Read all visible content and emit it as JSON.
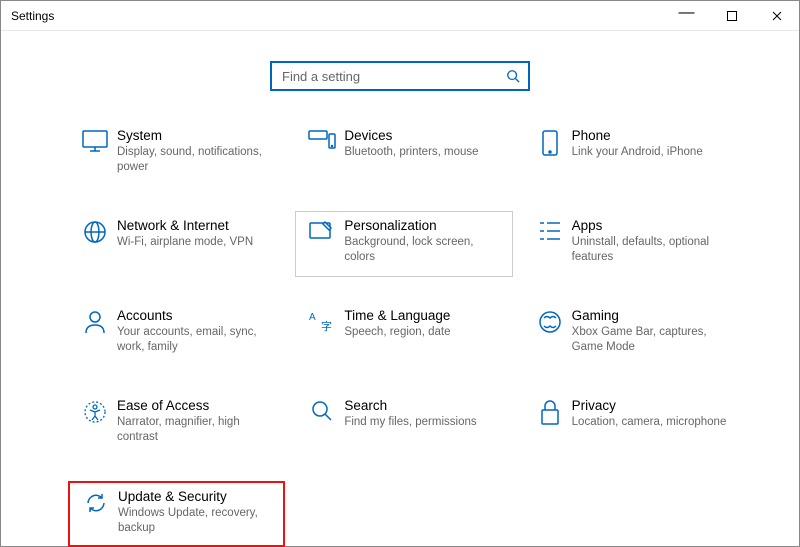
{
  "window": {
    "title": "Settings"
  },
  "search": {
    "placeholder": "Find a setting"
  },
  "tiles": {
    "system": {
      "title": "System",
      "desc": "Display, sound, notifications, power"
    },
    "devices": {
      "title": "Devices",
      "desc": "Bluetooth, printers, mouse"
    },
    "phone": {
      "title": "Phone",
      "desc": "Link your Android, iPhone"
    },
    "network": {
      "title": "Network & Internet",
      "desc": "Wi-Fi, airplane mode, VPN"
    },
    "personalization": {
      "title": "Personalization",
      "desc": "Background, lock screen, colors"
    },
    "apps": {
      "title": "Apps",
      "desc": "Uninstall, defaults, optional features"
    },
    "accounts": {
      "title": "Accounts",
      "desc": "Your accounts, email, sync, work, family"
    },
    "time": {
      "title": "Time & Language",
      "desc": "Speech, region, date"
    },
    "gaming": {
      "title": "Gaming",
      "desc": "Xbox Game Bar, captures, Game Mode"
    },
    "ease": {
      "title": "Ease of Access",
      "desc": "Narrator, magnifier, high contrast"
    },
    "search_tile": {
      "title": "Search",
      "desc": "Find my files, permissions"
    },
    "privacy": {
      "title": "Privacy",
      "desc": "Location, camera, microphone"
    },
    "update": {
      "title": "Update & Security",
      "desc": "Windows Update, recovery, backup"
    }
  }
}
